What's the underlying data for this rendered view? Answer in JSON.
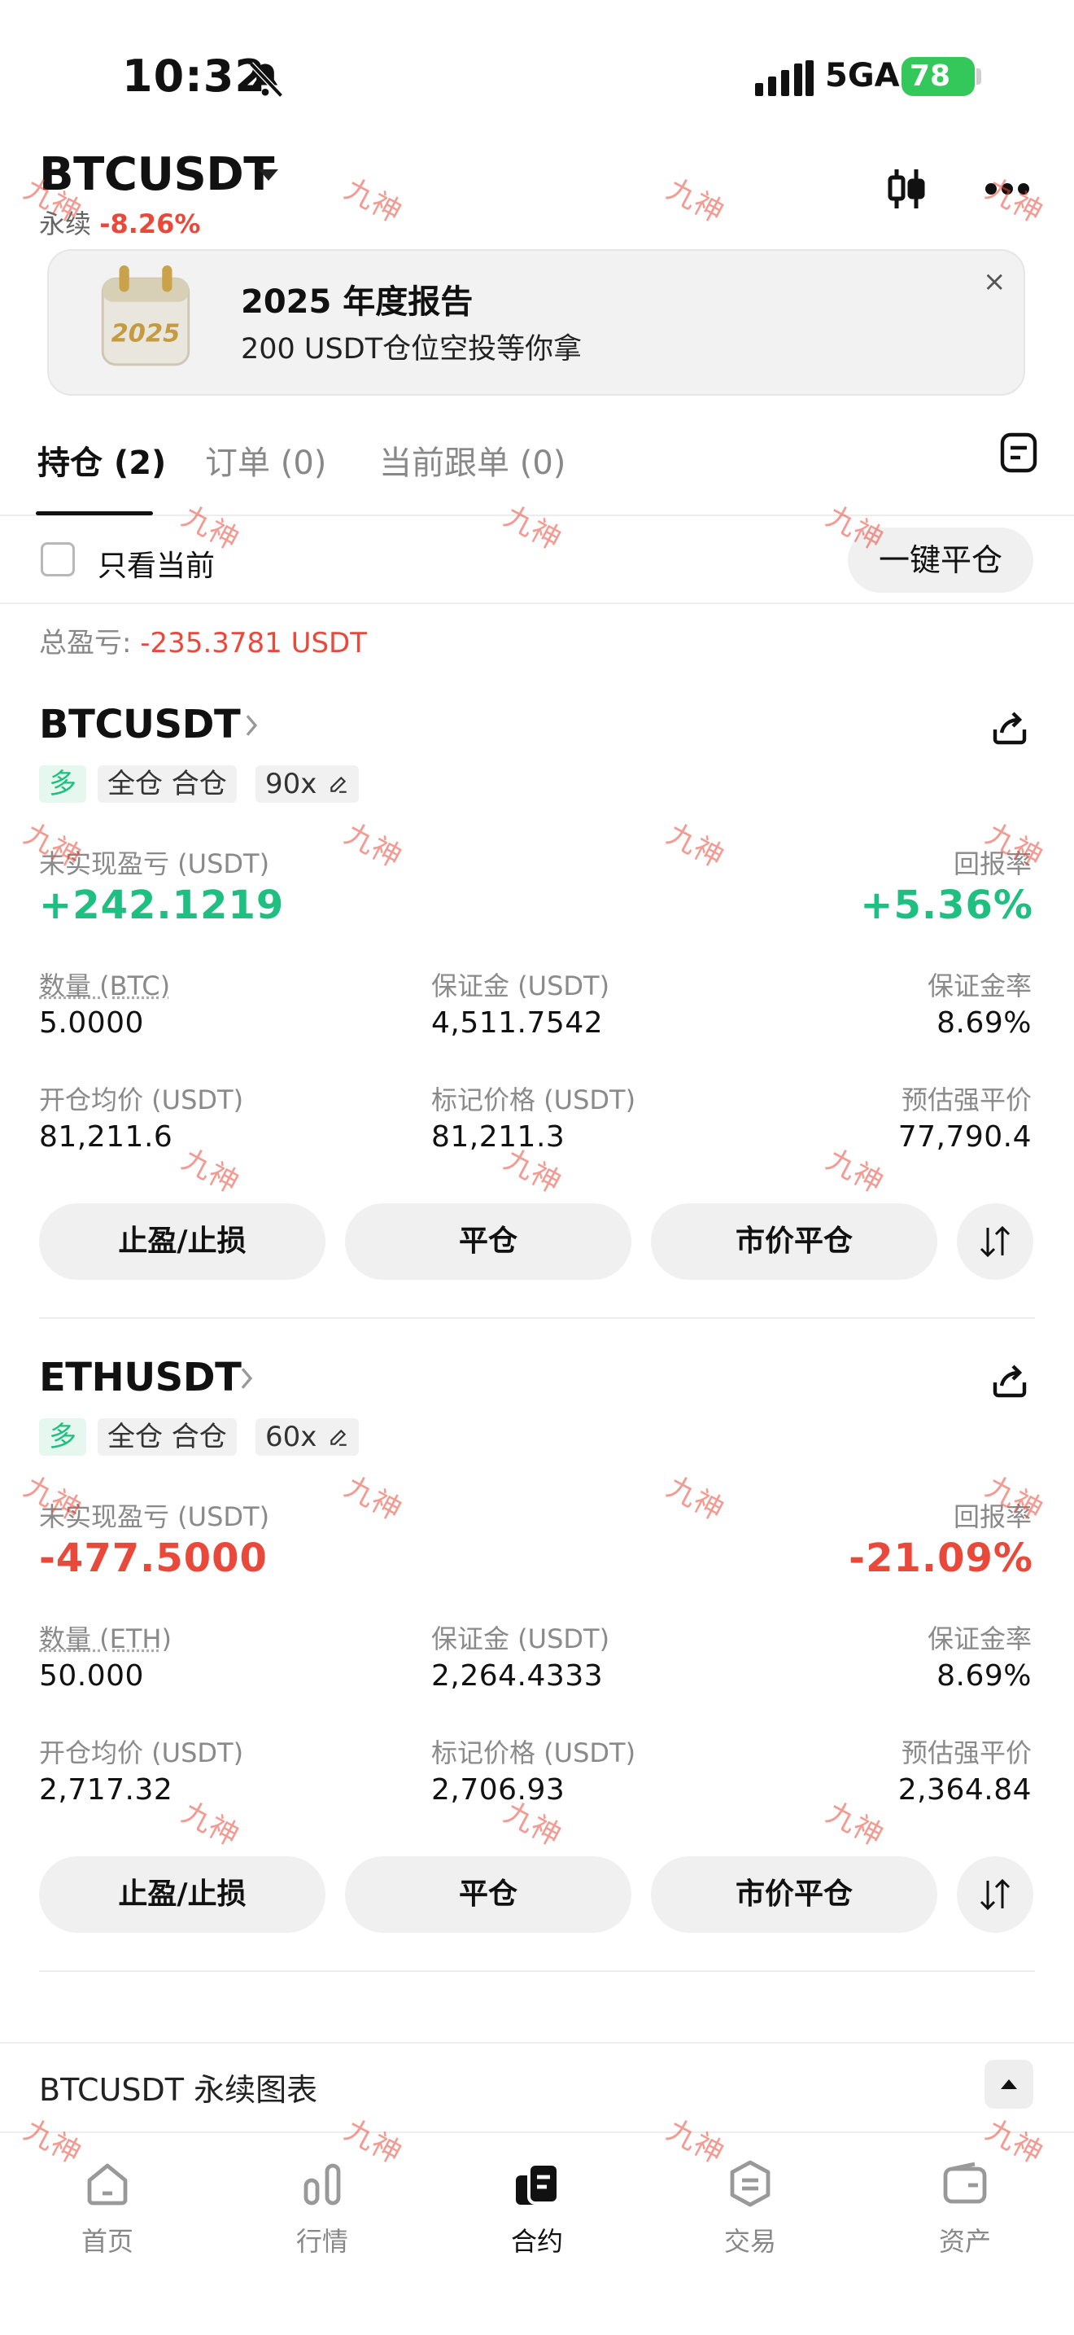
{
  "status_bar": {
    "time": "10:32",
    "network": "5GA",
    "battery": "78"
  },
  "header": {
    "symbol": "BTCUSDT",
    "type": "永续",
    "change": "-8.26%"
  },
  "banner": {
    "image_text": "2025",
    "title": "2025 年度报告",
    "subtitle": "200 USDT仓位空投等你拿",
    "close": "×"
  },
  "tabs": [
    {
      "label": "持仓 (2)",
      "active": true
    },
    {
      "label": "订单 (0)",
      "active": false
    },
    {
      "label": "当前跟单 (0)",
      "active": false
    }
  ],
  "filter": {
    "only_current": "只看当前",
    "close_all": "一键平仓"
  },
  "total": {
    "label": "总盈亏:",
    "value": "-235.3781 USDT"
  },
  "positions": [
    {
      "symbol": "BTCUSDT",
      "side": "多",
      "mode": "全仓 合仓",
      "leverage": "90x",
      "pnl_label": "未实现盈亏 (USDT)",
      "pnl": "+242.1219",
      "roe_label": "回报率",
      "roe": "+5.36%",
      "qty_label": "数量 (BTC)",
      "qty": "5.0000",
      "margin_label": "保证金 (USDT)",
      "margin": "4,511.7542",
      "margin_rate_label": "保证金率",
      "margin_rate": "8.69%",
      "entry_label": "开仓均价 (USDT)",
      "entry": "81,211.6",
      "mark_label": "标记价格 (USDT)",
      "mark": "81,211.3",
      "liq_label": "预估强平价",
      "liq": "77,790.4",
      "btn_tpsl": "止盈/止损",
      "btn_close": "平仓",
      "btn_market_close": "市价平仓"
    },
    {
      "symbol": "ETHUSDT",
      "side": "多",
      "mode": "全仓 合仓",
      "leverage": "60x",
      "pnl_label": "未实现盈亏 (USDT)",
      "pnl": "-477.5000",
      "roe_label": "回报率",
      "roe": "-21.09%",
      "qty_label": "数量 (ETH)",
      "qty": "50.000",
      "margin_label": "保证金 (USDT)",
      "margin": "2,264.4333",
      "margin_rate_label": "保证金率",
      "margin_rate": "8.69%",
      "entry_label": "开仓均价 (USDT)",
      "entry": "2,717.32",
      "mark_label": "标记价格 (USDT)",
      "mark": "2,706.93",
      "liq_label": "预估强平价",
      "liq": "2,364.84",
      "btn_tpsl": "止盈/止损",
      "btn_close": "平仓",
      "btn_market_close": "市价平仓"
    }
  ],
  "chart_section": {
    "title": "BTCUSDT 永续图表"
  },
  "nav": [
    {
      "label": "首页",
      "icon": "home-icon"
    },
    {
      "label": "行情",
      "icon": "market-icon"
    },
    {
      "label": "合约",
      "icon": "futures-icon",
      "active": true
    },
    {
      "label": "交易",
      "icon": "trade-icon"
    },
    {
      "label": "资产",
      "icon": "wallet-icon"
    }
  ],
  "watermark": "九神",
  "colors": {
    "positive": "#1fbf81",
    "negative": "#e8493a",
    "battery": "#34c759"
  }
}
